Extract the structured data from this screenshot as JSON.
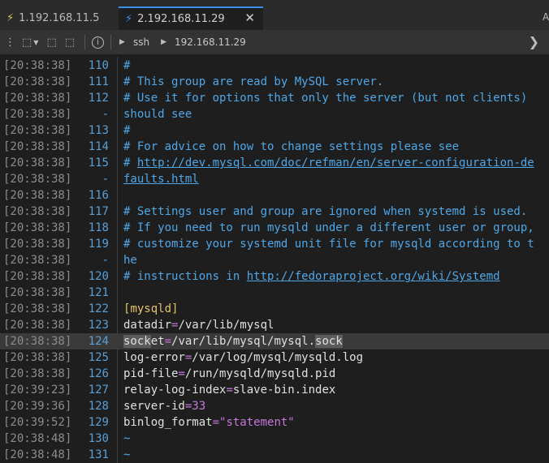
{
  "tabs": [
    {
      "label": "1.192.168.11.5",
      "active": false
    },
    {
      "label": "2.192.168.11.29",
      "active": true
    }
  ],
  "tab_overflow_label": "A",
  "toolbar": {
    "breadcrumb": [
      "ssh",
      "192.168.11.29"
    ]
  },
  "colors": {
    "accent": "#3b8eea",
    "comment": "#4ea7e8",
    "background": "#1e1e1e"
  },
  "terminal_lines": [
    {
      "ts": "[20:38:38]",
      "ln": "110",
      "text": "#"
    },
    {
      "ts": "[20:38:38]",
      "ln": "111",
      "text": "# This group are read by MySQL server."
    },
    {
      "ts": "[20:38:38]",
      "ln": "112",
      "text": "# Use it for options that only the server (but not clients)"
    },
    {
      "ts": "[20:38:38]",
      "ln": "-",
      "text": "should see"
    },
    {
      "ts": "[20:38:38]",
      "ln": "113",
      "text": "#"
    },
    {
      "ts": "[20:38:38]",
      "ln": "114",
      "text": "# For advice on how to change settings please see"
    },
    {
      "ts": "[20:38:38]",
      "ln": "115",
      "text_prefix": "# ",
      "url": "http://dev.mysql.com/doc/refman/en/server-configuration-de"
    },
    {
      "ts": "[20:38:38]",
      "ln": "-",
      "url": "faults.html"
    },
    {
      "ts": "[20:38:38]",
      "ln": "116",
      "text": ""
    },
    {
      "ts": "[20:38:38]",
      "ln": "117",
      "text": "# Settings user and group are ignored when systemd is used."
    },
    {
      "ts": "[20:38:38]",
      "ln": "118",
      "text": "# If you need to run mysqld under a different user or group,"
    },
    {
      "ts": "[20:38:38]",
      "ln": "119",
      "text": "# customize your systemd unit file for mysqld according to t"
    },
    {
      "ts": "[20:38:38]",
      "ln": "-",
      "text": "he"
    },
    {
      "ts": "[20:38:38]",
      "ln": "120",
      "text_prefix": "# instructions in ",
      "url": "http://fedoraproject.org/wiki/Systemd"
    },
    {
      "ts": "[20:38:38]",
      "ln": "121",
      "text": ""
    },
    {
      "ts": "[20:38:38]",
      "ln": "122",
      "section": "mysqld"
    },
    {
      "ts": "[20:38:38]",
      "ln": "123",
      "key": "datadir",
      "value": "/var/lib/mysql"
    },
    {
      "ts": "[20:38:38]",
      "ln": "124",
      "key": "socket",
      "value": "/var/lib/mysql/mysql.sock"
    },
    {
      "ts": "[20:38:38]",
      "ln": "125",
      "key": "log-error",
      "value": "/var/log/mysql/mysqld.log"
    },
    {
      "ts": "[20:38:38]",
      "ln": "126",
      "key": "pid-file",
      "value": "/run/mysqld/mysqld.pid"
    },
    {
      "ts": "[20:39:23]",
      "ln": "127",
      "key": "relay-log-index",
      "value": "slave-bin.index"
    },
    {
      "ts": "[20:39:36]",
      "ln": "128",
      "key": "server-id",
      "value": "33"
    },
    {
      "ts": "[20:39:52]",
      "ln": "129",
      "key": "binlog_format",
      "value": "\"statement\""
    },
    {
      "ts": "[20:38:48]",
      "ln": "130",
      "text": "~"
    },
    {
      "ts": "[20:38:48]",
      "ln": "131",
      "text": "~"
    }
  ]
}
